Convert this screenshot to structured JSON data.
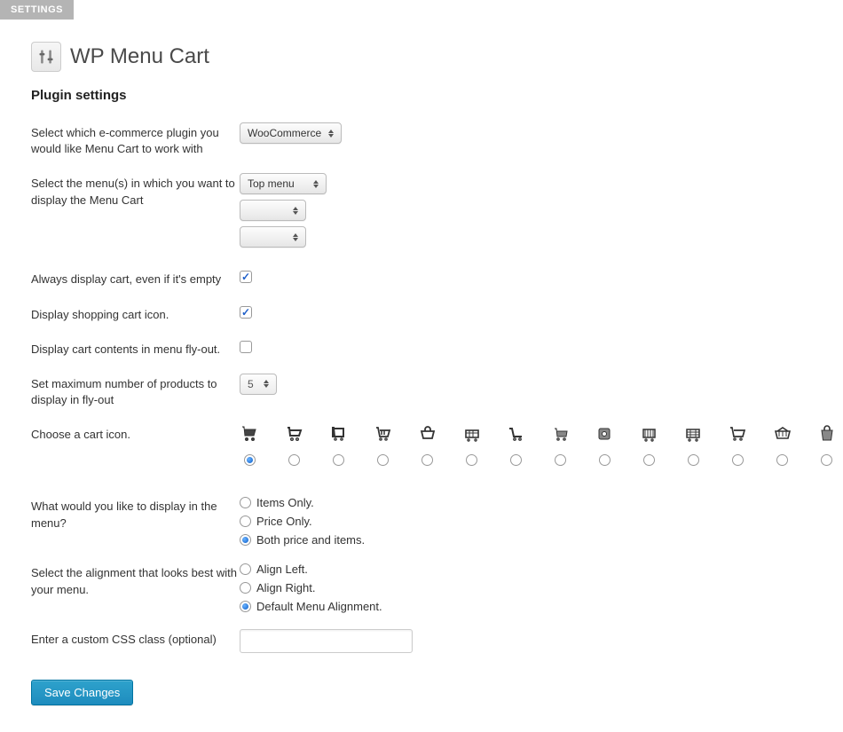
{
  "tab": {
    "label": "SETTINGS"
  },
  "header": {
    "title": "WP Menu Cart"
  },
  "section_title": "Plugin settings",
  "fields": {
    "plugin_select": {
      "label": "Select which e-commerce plugin you would like Menu Cart to work with",
      "value": "WooCommerce"
    },
    "menu_select": {
      "label": "Select the menu(s) in which you want to display the Menu Cart",
      "value1": "Top menu",
      "value2": "",
      "value3": ""
    },
    "always_display": {
      "label": "Always display cart, even if it's empty",
      "checked": true
    },
    "display_icon": {
      "label": "Display shopping cart icon.",
      "checked": true
    },
    "flyout": {
      "label": "Display cart contents in menu fly-out.",
      "checked": false
    },
    "max_products": {
      "label": "Set maximum number of products to display in fly-out",
      "value": "5"
    },
    "choose_icon": {
      "label": "Choose a cart icon.",
      "selected_index": 0,
      "count": 14
    },
    "display_what": {
      "label": "What would you like to display in the menu?",
      "options": [
        "Items Only.",
        "Price Only.",
        "Both price and items."
      ],
      "selected_index": 2
    },
    "alignment": {
      "label": "Select the alignment that looks best with your menu.",
      "options": [
        "Align Left.",
        "Align Right.",
        "Default Menu Alignment."
      ],
      "selected_index": 2
    },
    "css_class": {
      "label": "Enter a custom CSS class (optional)",
      "value": ""
    }
  },
  "save_button": "Save Changes"
}
